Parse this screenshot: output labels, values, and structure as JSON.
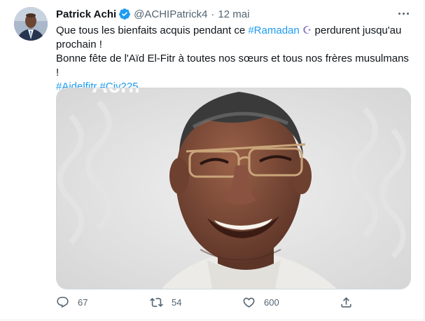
{
  "author": {
    "display_name": "Patrick Achi",
    "handle": "@ACHIPatrick4",
    "verified_icon": "verified-badge-icon"
  },
  "tweet": {
    "date": "12 mai",
    "separator": "·",
    "line1": {
      "before_hashtag": "Que tous les bienfaits acquis pendant ce ",
      "hashtag": "#Ramadan",
      "emoji": "☪",
      "after": " perdurent jusqu'au prochain !"
    },
    "line2": "Bonne fête de l'Aïd El-Fitr à toutes nos sœurs et tous nos frères musulmans !",
    "hashtags": [
      "#Aidelfitr",
      "#Civ225"
    ],
    "media": {
      "type": "photo",
      "alt": "Portrait of a smiling man wearing glasses"
    }
  },
  "actions": {
    "replies": "67",
    "retweets": "54",
    "likes": "600"
  },
  "colors": {
    "link": "#1d9bf0",
    "verified": "#1d9bf0",
    "secondary_text": "#536471"
  }
}
